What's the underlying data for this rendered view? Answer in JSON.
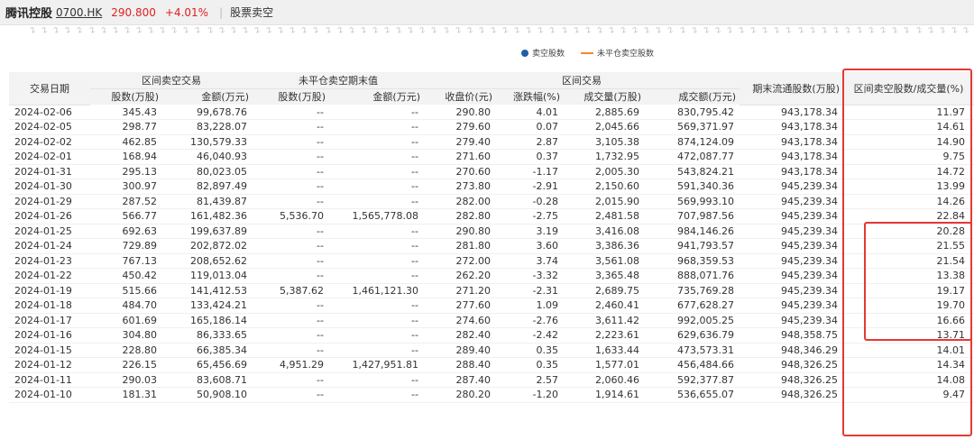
{
  "header": {
    "stock_name": "腾讯控股",
    "stock_code": "0700.HK",
    "price": "290.800",
    "change_pct": "+4.01%",
    "separator": "|",
    "tab_label": "股票卖空"
  },
  "axis_tick_label": "2",
  "legend": {
    "short_shares": "卖空股数",
    "unclosed_shares": "未平仓卖空股数"
  },
  "table": {
    "header_top": {
      "date": "交易日期",
      "interval_short": "区间卖空交易",
      "unclosed": "未平仓卖空期末值",
      "interval_trade": "区间交易",
      "float_shares": "期末流通股数(万股)",
      "short_ratio": "区间卖空股数/成交量(%)"
    },
    "header_sub": [
      "股数(万股)",
      "金额(万元)",
      "股数(万股)",
      "金额(万元)",
      "收盘价(元)",
      "涨跌幅(%)",
      "成交量(万股)",
      "成交额(万元)"
    ],
    "rows": [
      [
        "2024-02-06",
        "345.43",
        "99,678.76",
        "--",
        "--",
        "290.80",
        "4.01",
        "2,885.69",
        "830,795.42",
        "943,178.34",
        "11.97"
      ],
      [
        "2024-02-05",
        "298.77",
        "83,228.07",
        "--",
        "--",
        "279.60",
        "0.07",
        "2,045.66",
        "569,371.97",
        "943,178.34",
        "14.61"
      ],
      [
        "2024-02-02",
        "462.85",
        "130,579.33",
        "--",
        "--",
        "279.40",
        "2.87",
        "3,105.38",
        "874,124.09",
        "943,178.34",
        "14.90"
      ],
      [
        "2024-02-01",
        "168.94",
        "46,040.93",
        "--",
        "--",
        "271.60",
        "0.37",
        "1,732.95",
        "472,087.77",
        "943,178.34",
        "9.75"
      ],
      [
        "2024-01-31",
        "295.13",
        "80,023.05",
        "--",
        "--",
        "270.60",
        "-1.17",
        "2,005.30",
        "543,824.21",
        "943,178.34",
        "14.72"
      ],
      [
        "2024-01-30",
        "300.97",
        "82,897.49",
        "--",
        "--",
        "273.80",
        "-2.91",
        "2,150.60",
        "591,340.36",
        "945,239.34",
        "13.99"
      ],
      [
        "2024-01-29",
        "287.52",
        "81,439.87",
        "--",
        "--",
        "282.00",
        "-0.28",
        "2,015.90",
        "569,993.10",
        "945,239.34",
        "14.26"
      ],
      [
        "2024-01-26",
        "566.77",
        "161,482.36",
        "5,536.70",
        "1,565,778.08",
        "282.80",
        "-2.75",
        "2,481.58",
        "707,987.56",
        "945,239.34",
        "22.84"
      ],
      [
        "2024-01-25",
        "692.63",
        "199,637.89",
        "--",
        "--",
        "290.80",
        "3.19",
        "3,416.08",
        "984,146.26",
        "945,239.34",
        "20.28"
      ],
      [
        "2024-01-24",
        "729.89",
        "202,872.02",
        "--",
        "--",
        "281.80",
        "3.60",
        "3,386.36",
        "941,793.57",
        "945,239.34",
        "21.55"
      ],
      [
        "2024-01-23",
        "767.13",
        "208,652.62",
        "--",
        "--",
        "272.00",
        "3.74",
        "3,561.08",
        "968,359.53",
        "945,239.34",
        "21.54"
      ],
      [
        "2024-01-22",
        "450.42",
        "119,013.04",
        "--",
        "--",
        "262.20",
        "-3.32",
        "3,365.48",
        "888,071.76",
        "945,239.34",
        "13.38"
      ],
      [
        "2024-01-19",
        "515.66",
        "141,412.53",
        "5,387.62",
        "1,461,121.30",
        "271.20",
        "-2.31",
        "2,689.75",
        "735,769.28",
        "945,239.34",
        "19.17"
      ],
      [
        "2024-01-18",
        "484.70",
        "133,424.21",
        "--",
        "--",
        "277.60",
        "1.09",
        "2,460.41",
        "677,628.27",
        "945,239.34",
        "19.70"
      ],
      [
        "2024-01-17",
        "601.69",
        "165,186.14",
        "--",
        "--",
        "274.60",
        "-2.76",
        "3,611.42",
        "992,005.25",
        "945,239.34",
        "16.66"
      ],
      [
        "2024-01-16",
        "304.80",
        "86,333.65",
        "--",
        "--",
        "282.40",
        "-2.42",
        "2,223.61",
        "629,636.79",
        "948,358.75",
        "13.71"
      ],
      [
        "2024-01-15",
        "228.80",
        "66,385.34",
        "--",
        "--",
        "289.40",
        "0.35",
        "1,633.44",
        "473,573.31",
        "948,346.29",
        "14.01"
      ],
      [
        "2024-01-12",
        "226.15",
        "65,456.69",
        "4,951.29",
        "1,427,951.81",
        "288.40",
        "0.35",
        "1,577.01",
        "456,484.66",
        "948,326.25",
        "14.34"
      ],
      [
        "2024-01-11",
        "290.03",
        "83,608.71",
        "--",
        "--",
        "287.40",
        "2.57",
        "2,060.46",
        "592,377.87",
        "948,326.25",
        "14.08"
      ],
      [
        "2024-01-10",
        "181.31",
        "50,908.10",
        "--",
        "--",
        "280.20",
        "-1.20",
        "1,914.61",
        "536,655.07",
        "948,326.25",
        "9.47"
      ]
    ]
  },
  "colors": {
    "price_up": "#e02020",
    "legend_dot": "#1e5fa8",
    "legend_line": "#f28c28",
    "highlight_box": "#e53935"
  }
}
